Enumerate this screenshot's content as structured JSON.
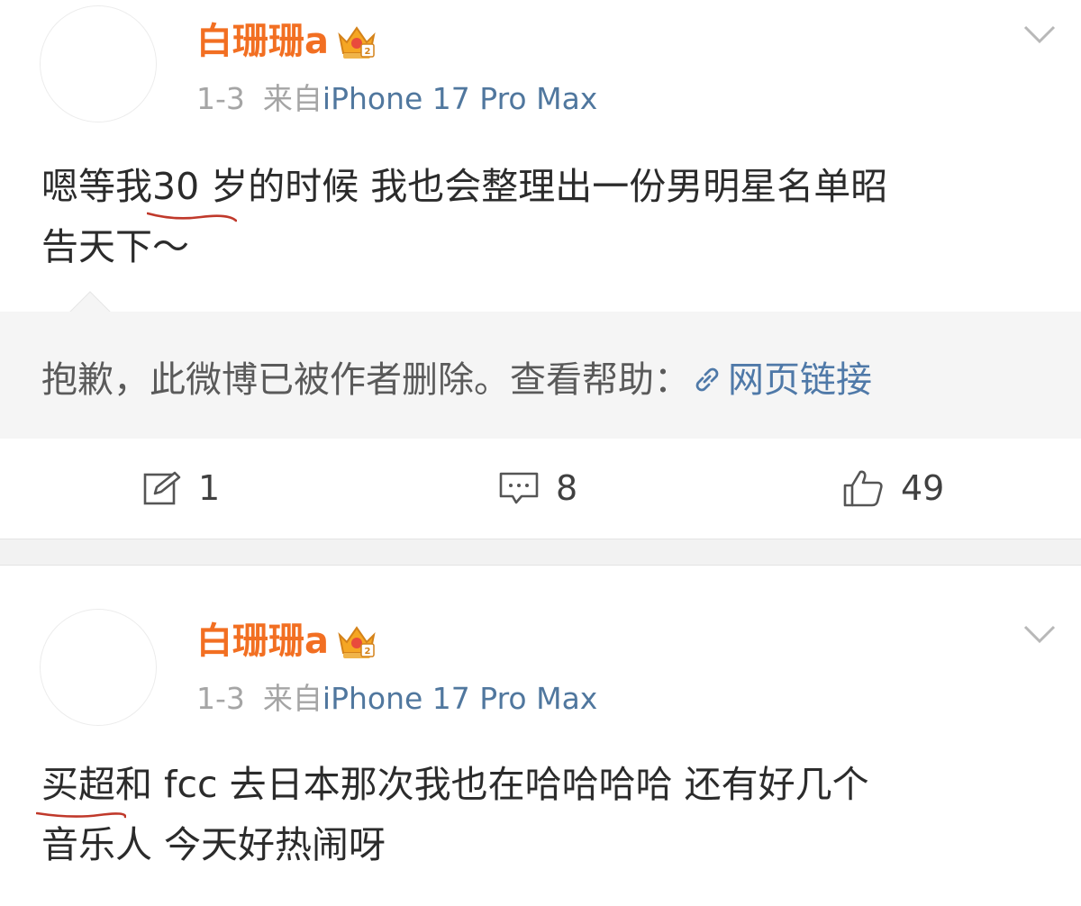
{
  "posts": [
    {
      "username": "白珊珊a",
      "date": "1-3",
      "source_prefix": "来自",
      "source_device": "iPhone 17 Pro Max",
      "text_line1_before": "嗯等我",
      "text_line1_highlight": "30 岁的时候",
      "text_line1_after": " 我也会整理出一份男明星名单昭",
      "text_line2": "告天下～",
      "deleted_notice": "抱歉，此微博已被作者删除。查看帮助：",
      "deleted_link": "网页链接",
      "actions": {
        "repost_count": "1",
        "comment_count": "8",
        "like_count": "49"
      }
    },
    {
      "username": "白珊珊a",
      "date": "1-3",
      "source_prefix": "来自",
      "source_device": "iPhone 17 Pro Max",
      "text_line1_highlight": "买超和 fcc 去日本",
      "text_line1_after": "那次我也在哈哈哈哈 还有好几个",
      "text_line2": "音乐人 今天好热闹呀"
    }
  ],
  "icons": {
    "crown": "crown-badge-icon",
    "chevron": "chevron-down-icon",
    "link": "link-icon",
    "repost": "repost-icon",
    "comment": "comment-icon",
    "like": "thumbs-up-icon"
  },
  "colors": {
    "username": "#f26f22",
    "source": "#50779e",
    "link": "#4f79a8",
    "underline": "#c0392b",
    "repost_bg": "#f5f5f5",
    "separator": "#f2f2f2"
  }
}
